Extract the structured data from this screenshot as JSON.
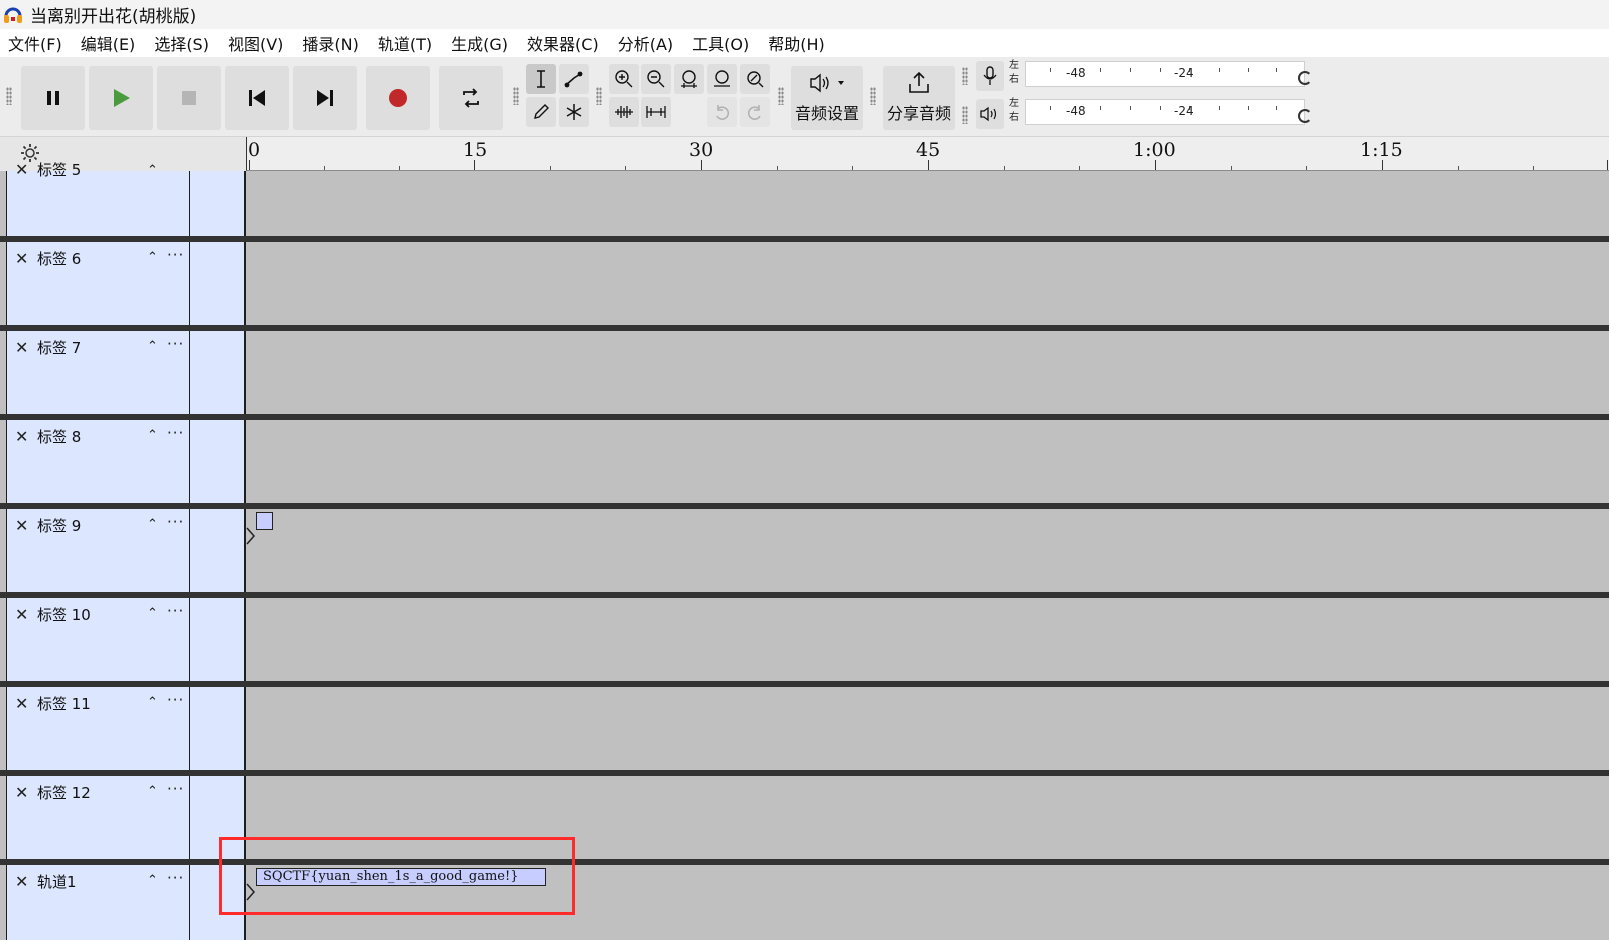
{
  "window": {
    "title": "当离别开出花(胡桃版)"
  },
  "menubar": {
    "items": [
      "文件(F)",
      "编辑(E)",
      "选择(S)",
      "视图(V)",
      "播录(N)",
      "轨道(T)",
      "生成(G)",
      "效果器(C)",
      "分析(A)",
      "工具(O)",
      "帮助(H)"
    ]
  },
  "toolbar": {
    "audio_setup_label": "音频设置",
    "share_audio_label": "分享音频",
    "meter_left_right": "左\n右",
    "record_meter": {
      "ticks": [
        "-48",
        "-24"
      ]
    },
    "play_meter": {
      "ticks": [
        "-48",
        "-24"
      ]
    },
    "colors": {
      "play": "#4a9a3e",
      "record": "#c0282a"
    }
  },
  "ruler": {
    "ticks": [
      "0",
      "15",
      "30",
      "45",
      "1:00",
      "1:15"
    ]
  },
  "tracks": [
    {
      "name": "标签 5",
      "partial": true
    },
    {
      "name": "标签 6"
    },
    {
      "name": "标签 7"
    },
    {
      "name": "标签 8"
    },
    {
      "name": "标签 9"
    },
    {
      "name": "标签 10"
    },
    {
      "name": "标签 11"
    },
    {
      "name": "标签 12"
    },
    {
      "name": "轨道1"
    }
  ],
  "labels": {
    "track1_label_text": "SQCTF{yuan_shen_1s_a_good_game!}"
  }
}
